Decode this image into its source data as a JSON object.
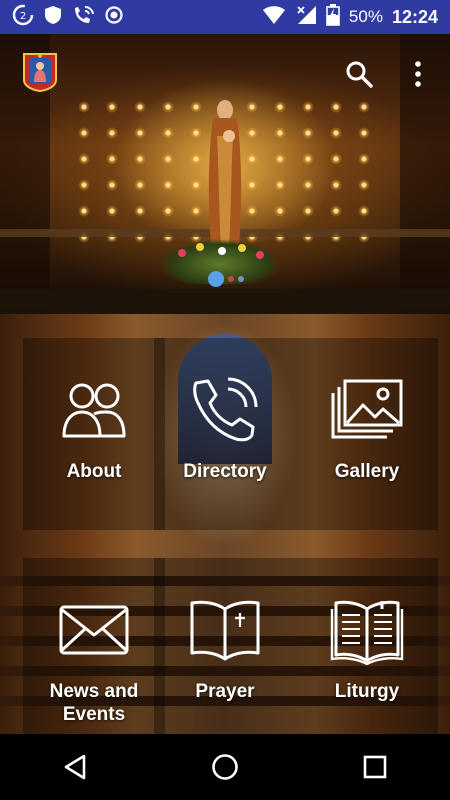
{
  "status_bar": {
    "battery": "50%",
    "time": "12:24"
  },
  "tiles": [
    {
      "label": "About",
      "icon": "people-icon"
    },
    {
      "label": "Directory",
      "icon": "phone-icon"
    },
    {
      "label": "Gallery",
      "icon": "gallery-icon"
    },
    {
      "label": "News and\nEvents",
      "icon": "envelope-icon"
    },
    {
      "label": "Prayer",
      "icon": "open-book-icon"
    },
    {
      "label": "Liturgy",
      "icon": "liturgy-book-icon"
    }
  ],
  "carousel": {
    "pages": 3,
    "active": 0
  },
  "colors": {
    "status_bar": "#2f3aa3",
    "dot_active": "#5aa0ea",
    "tile_text": "#ffffff"
  }
}
